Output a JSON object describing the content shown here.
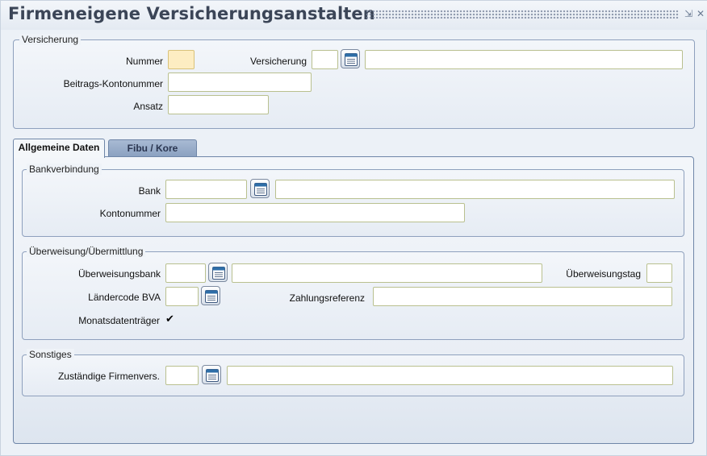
{
  "window": {
    "title": "Firmeneigene Versicherungsanstalten",
    "minimize_icon": "minimize-icon",
    "close_icon": "close-icon"
  },
  "versicherung": {
    "legend": "Versicherung",
    "nummer_label": "Nummer",
    "nummer_value": "",
    "versicherung_label": "Versicherung",
    "versicherung_code": "",
    "versicherung_name": "",
    "beitrags_label": "Beitrags-Kontonummer",
    "beitrags_value": "",
    "ansatz_label": "Ansatz",
    "ansatz_value": ""
  },
  "tabs": [
    {
      "label": "Allgemeine Daten",
      "active": true
    },
    {
      "label": "Fibu / Kore",
      "active": false
    }
  ],
  "bankverbindung": {
    "legend": "Bankverbindung",
    "bank_label": "Bank",
    "bank_code": "",
    "bank_name": "",
    "konto_label": "Kontonummer",
    "konto_value": ""
  },
  "ueberweisung": {
    "legend": "Überweisung/Übermittlung",
    "bank_label": "Überweisungsbank",
    "bank_code": "",
    "bank_name": "",
    "tag_label": "Überweisungstag",
    "tag_value": "",
    "laendercode_label": "Ländercode BVA",
    "laendercode_value": "",
    "zahlungsref_label": "Zahlungsreferenz",
    "zahlungsref_value": "",
    "monats_label": "Monatsdatenträger",
    "monats_checked": true,
    "check_glyph": "✔"
  },
  "sonstiges": {
    "legend": "Sonstiges",
    "firmenvers_label": "Zuständige Firmenvers.",
    "firmenvers_code": "",
    "firmenvers_name": ""
  },
  "icons": {
    "lov": "calendar-list-icon"
  },
  "colors": {
    "title": "#3b4557",
    "required_field": "#fdedc2",
    "tab_inactive": "#8aa0c0",
    "border": "#8ea0bd"
  }
}
